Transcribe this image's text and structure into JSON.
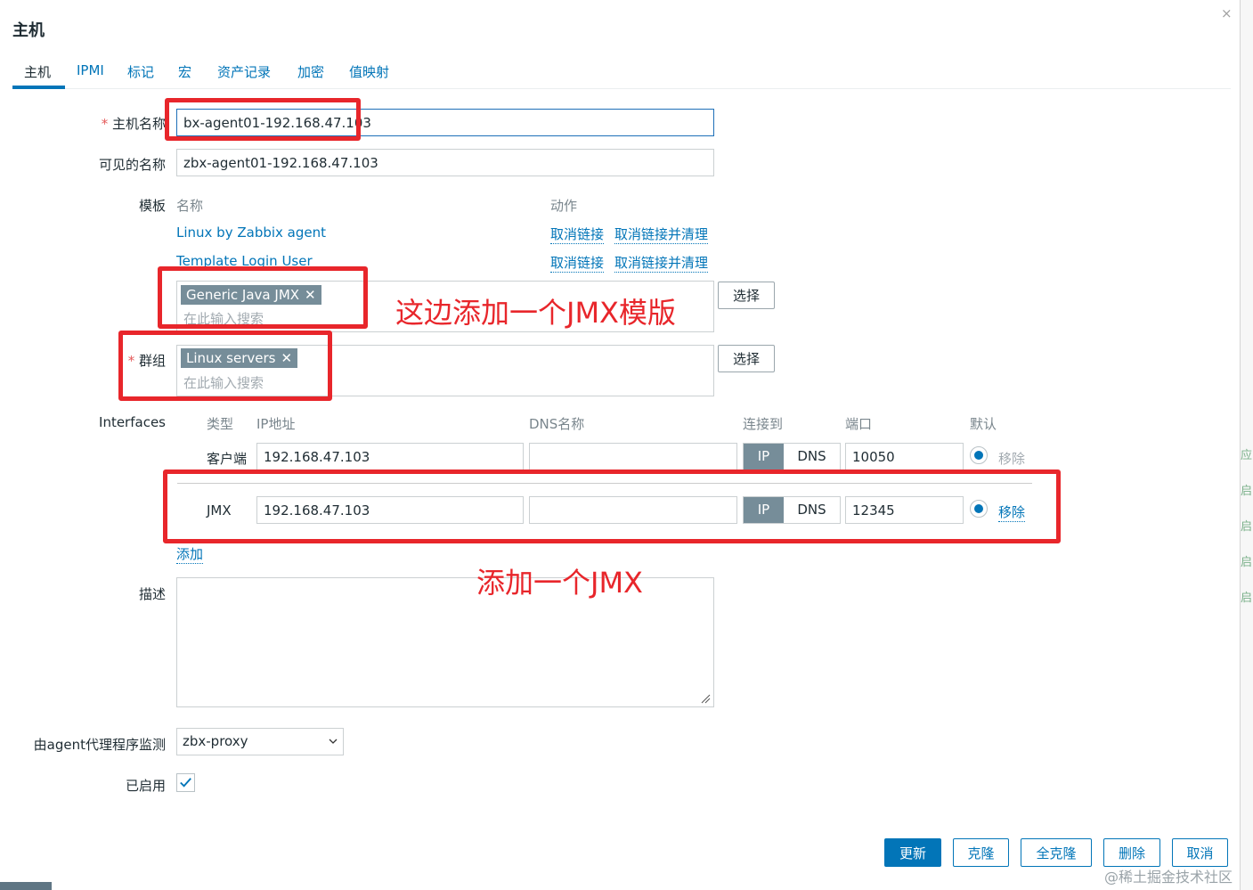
{
  "dialog": {
    "title": "主机",
    "close_glyph": "×"
  },
  "tabs": [
    {
      "label": "主机",
      "active": true
    },
    {
      "label": "IPMI"
    },
    {
      "label": "标记"
    },
    {
      "label": "宏"
    },
    {
      "label": "资产记录"
    },
    {
      "label": "加密"
    },
    {
      "label": "值映射"
    }
  ],
  "host": {
    "required_mark": "*",
    "hostname_label": "主机名称",
    "hostname_value": "bx-agent01-192.168.47.103",
    "visible_name_label": "可见的名称",
    "visible_name_value": "zbx-agent01-192.168.47.103"
  },
  "templates": {
    "label": "模板",
    "col_name": "名称",
    "col_action": "动作",
    "linked": [
      {
        "name": "Linux by Zabbix agent",
        "unlink": "取消链接",
        "unlink_clear": "取消链接并清理"
      },
      {
        "name": "Template Login User",
        "unlink": "取消链接",
        "unlink_clear": "取消链接并清理"
      }
    ],
    "selected_chip": "Generic Java JMX",
    "search_placeholder": "在此输入搜索",
    "select_button": "选择"
  },
  "groups": {
    "label": "群组",
    "selected_chip": "Linux servers",
    "search_placeholder": "在此输入搜索",
    "select_button": "选择"
  },
  "interfaces": {
    "label": "Interfaces",
    "headers": {
      "type": "类型",
      "ip": "IP地址",
      "dns": "DNS名称",
      "connect": "连接到",
      "port": "端口",
      "default": "默认"
    },
    "rows": [
      {
        "type": "客户端",
        "ip": "192.168.47.103",
        "dns": "",
        "ip_btn": "IP",
        "dns_btn": "DNS",
        "port": "10050",
        "remove": "移除",
        "remove_enabled": false
      },
      {
        "type": "JMX",
        "ip": "192.168.47.103",
        "dns": "",
        "ip_btn": "IP",
        "dns_btn": "DNS",
        "port": "12345",
        "remove": "移除",
        "remove_enabled": true
      }
    ],
    "add_link": "添加"
  },
  "description": {
    "label": "描述",
    "value": ""
  },
  "proxy": {
    "label": "由agent代理程序监测",
    "value": "zbx-proxy"
  },
  "enabled": {
    "label": "已启用",
    "checked": true
  },
  "buttons": {
    "update": "更新",
    "clone": "克隆",
    "full_clone": "全克隆",
    "delete": "删除",
    "cancel": "取消"
  },
  "annotations": {
    "template_note": "这边添加一个JMX模版",
    "jmx_note": "添加一个JMX"
  },
  "watermark": "@稀土掘金技术社区",
  "right_strip_glyphs": [
    "应",
    "启",
    "启",
    "启",
    "启"
  ],
  "colors": {
    "accent": "#0275b8",
    "annotation_red": "#e8262b",
    "chip_bg": "#768d99"
  }
}
